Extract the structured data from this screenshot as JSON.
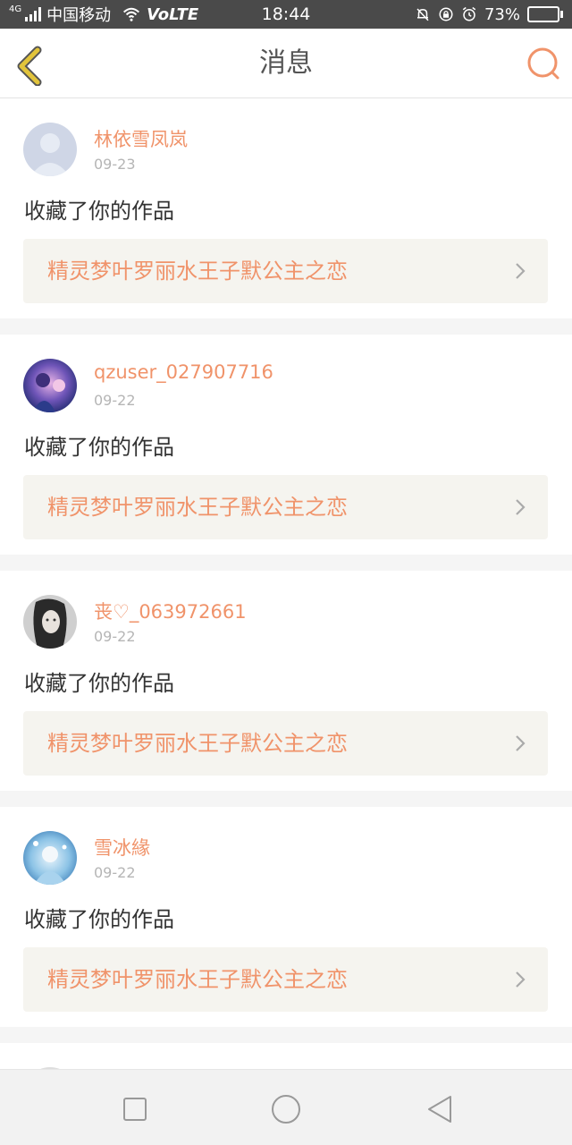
{
  "status_bar": {
    "network_type": "4G",
    "carrier": "中国移动",
    "volte": "VoLTE",
    "time": "18:44",
    "battery_percent": "73%",
    "battery_level": 0.73
  },
  "header": {
    "title": "消息",
    "back_icon": "chevron-left-icon",
    "search_icon": "search-icon"
  },
  "colors": {
    "accent": "#f0936a",
    "back_icon": "#e2c43b"
  },
  "messages": [
    {
      "username": "林依雪凤岚",
      "date": "09-23",
      "action": "收藏了你的作品",
      "work_title": "精灵梦叶罗丽水王子默公主之恋"
    },
    {
      "username": "qzuser_027907716",
      "date": "09-22",
      "action": "收藏了你的作品",
      "work_title": "精灵梦叶罗丽水王子默公主之恋"
    },
    {
      "username": "丧♡_063972661",
      "date": "09-22",
      "action": "收藏了你的作品",
      "work_title": "精灵梦叶罗丽水王子默公主之恋"
    },
    {
      "username": "雪冰緣",
      "date": "09-22",
      "action": "收藏了你的作品",
      "work_title": "精灵梦叶罗丽水王子默公主之恋"
    }
  ],
  "system_nav": {
    "recent_icon": "square-icon",
    "home_icon": "circle-icon",
    "back_icon": "triangle-back-icon"
  }
}
